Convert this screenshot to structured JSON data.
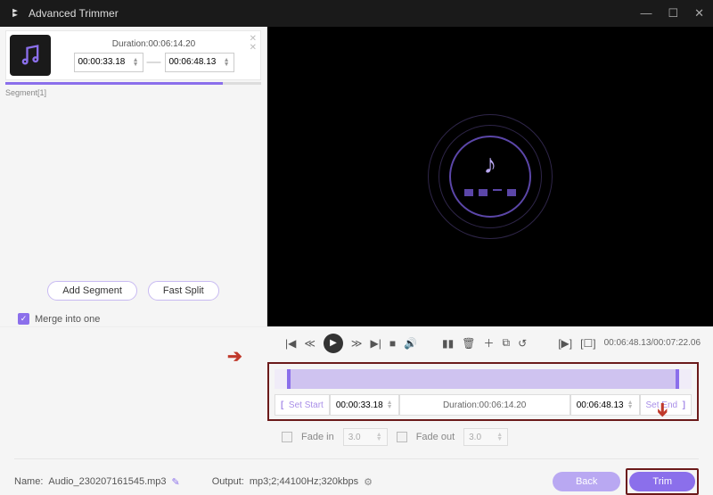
{
  "titlebar": {
    "title": "Advanced Trimmer"
  },
  "segment": {
    "label": "Segment[1]",
    "duration_prefix": "Duration:",
    "duration": "00:06:14.20",
    "start": "00:00:33.18",
    "end": "00:06:48.13"
  },
  "sidebar": {
    "add_segment": "Add Segment",
    "fast_split": "Fast Split",
    "merge_label": "Merge into one"
  },
  "controls": {
    "time_left": "00:06:48.13",
    "time_right": "00:07:22.06"
  },
  "trim": {
    "set_start": "Set Start",
    "start_val": "00:00:33.18",
    "duration_prefix": "Duration:",
    "duration_val": "00:06:14.20",
    "end_val": "00:06:48.13",
    "set_end": "Set End"
  },
  "fade": {
    "in_label": "Fade in",
    "in_val": "3.0",
    "out_label": "Fade out",
    "out_val": "3.0"
  },
  "footer": {
    "name_label": "Name:",
    "name_val": "Audio_230207161545.mp3",
    "output_label": "Output:",
    "output_val": "mp3;2;44100Hz;320kbps",
    "back": "Back",
    "trim": "Trim"
  }
}
